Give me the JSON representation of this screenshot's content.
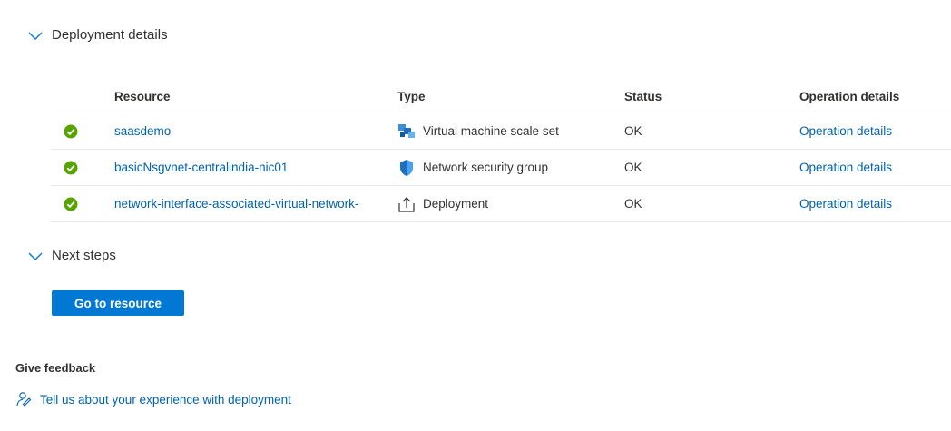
{
  "deployment_details": {
    "title": "Deployment details",
    "columns": {
      "resource": "Resource",
      "type": "Type",
      "status": "Status",
      "operation": "Operation details"
    },
    "rows": [
      {
        "resource": "saasdemo",
        "type": "Virtual machine scale set",
        "type_icon": "vmss-icon",
        "status": "OK",
        "operation": "Operation details",
        "state_icon": "success-check-icon"
      },
      {
        "resource": "basicNsgvnet-centralindia-nic01",
        "type": "Network security group",
        "type_icon": "nsg-shield-icon",
        "status": "OK",
        "operation": "Operation details",
        "state_icon": "success-check-icon"
      },
      {
        "resource": "network-interface-associated-virtual-network-",
        "type": "Deployment",
        "type_icon": "deployment-upload-icon",
        "status": "OK",
        "operation": "Operation details",
        "state_icon": "success-check-icon"
      }
    ]
  },
  "next_steps": {
    "title": "Next steps",
    "button_label": "Go to resource"
  },
  "feedback": {
    "title": "Give feedback",
    "link_label": "Tell us about your experience with deployment",
    "icon": "feedback-icon"
  },
  "colors": {
    "link": "#0062ad",
    "primary_button": "#0078d4",
    "success": "#57a300",
    "text": "#323130",
    "divider": "#edebe9"
  }
}
